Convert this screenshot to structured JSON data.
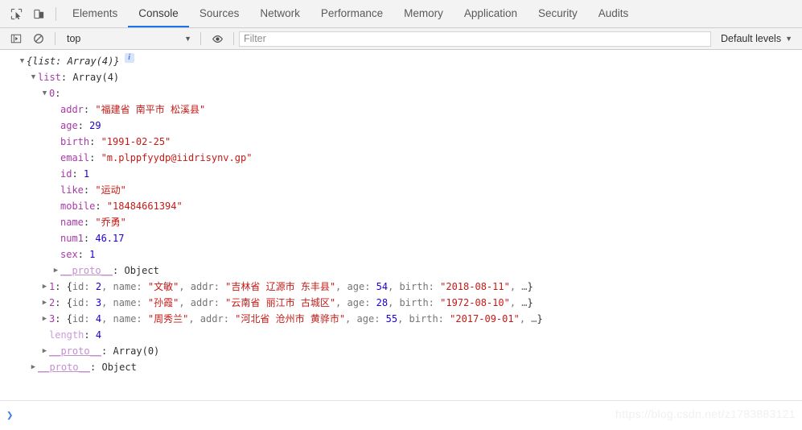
{
  "toolbar": {
    "inspect_icon": "inspect-cursor-icon",
    "device_icon": "device-toolbar-icon",
    "tabs": [
      {
        "label": "Elements",
        "selected": false
      },
      {
        "label": "Console",
        "selected": true
      },
      {
        "label": "Sources",
        "selected": false
      },
      {
        "label": "Network",
        "selected": false
      },
      {
        "label": "Performance",
        "selected": false
      },
      {
        "label": "Memory",
        "selected": false
      },
      {
        "label": "Application",
        "selected": false
      },
      {
        "label": "Security",
        "selected": false
      },
      {
        "label": "Audits",
        "selected": false
      }
    ]
  },
  "filterbar": {
    "sidebar_icon": "console-sidebar-icon",
    "clear_icon": "clear-console-icon",
    "context": "top",
    "context_caret": "▼",
    "eye_icon": "live-expression-eye-icon",
    "filter_placeholder": "Filter",
    "filter_value": "",
    "levels_label": "Default levels",
    "levels_caret": "▼"
  },
  "console": {
    "root": {
      "arrow": "▼",
      "summary": "{list: Array(4)}",
      "badge": "i"
    },
    "list_row": {
      "arrow": "▼",
      "name": "list",
      "value": "Array(4)"
    },
    "item0": {
      "arrow": "▼",
      "index": "0",
      "props": [
        {
          "name": "addr",
          "value": "\"福建省 南平市 松溪县\"",
          "type": "string"
        },
        {
          "name": "age",
          "value": "29",
          "type": "number"
        },
        {
          "name": "birth",
          "value": "\"1991-02-25\"",
          "type": "string"
        },
        {
          "name": "email",
          "value": "\"m.plppfyydp@iidrisynv.gp\"",
          "type": "string"
        },
        {
          "name": "id",
          "value": "1",
          "type": "number"
        },
        {
          "name": "like",
          "value": "\"运动\"",
          "type": "string"
        },
        {
          "name": "mobile",
          "value": "\"18484661394\"",
          "type": "string"
        },
        {
          "name": "name",
          "value": "\"乔勇\"",
          "type": "string"
        },
        {
          "name": "num1",
          "value": "46.17",
          "type": "number"
        },
        {
          "name": "sex",
          "value": "1",
          "type": "number"
        }
      ],
      "proto": {
        "arrow": "▶",
        "name": "__proto__",
        "value": "Object"
      }
    },
    "collapsed_items": [
      {
        "arrow": "▶",
        "index": "1",
        "id": "2",
        "name": "\"文敏\"",
        "addr": "\"吉林省 辽源市 东丰县\"",
        "age": "54",
        "birth": "\"2018-08-11\"",
        "ellipsis": "…"
      },
      {
        "arrow": "▶",
        "index": "2",
        "id": "3",
        "name": "\"孙霞\"",
        "addr": "\"云南省 丽江市 古城区\"",
        "age": "28",
        "birth": "\"1972-08-10\"",
        "ellipsis": "…"
      },
      {
        "arrow": "▶",
        "index": "3",
        "id": "4",
        "name": "\"周秀兰\"",
        "addr": "\"河北省 沧州市 黄骅市\"",
        "age": "55",
        "birth": "\"2017-09-01\"",
        "ellipsis": "…"
      }
    ],
    "length_row": {
      "name": "length",
      "value": "4"
    },
    "array_proto": {
      "arrow": "▶",
      "name": "__proto__",
      "value": "Array(0)"
    },
    "object_proto": {
      "arrow": "▶",
      "name": "__proto__",
      "value": "Object"
    },
    "labels": {
      "key_id": "id",
      "key_name": "name",
      "key_addr": "addr",
      "key_age": "age",
      "key_birth": "birth",
      "colon": ": ",
      "comma": ", ",
      "brace_open": "{",
      "brace_close": "}"
    }
  },
  "prompt": {
    "caret": "❯",
    "value": ""
  },
  "watermark": "https://blog.csdn.net/z1783883121"
}
